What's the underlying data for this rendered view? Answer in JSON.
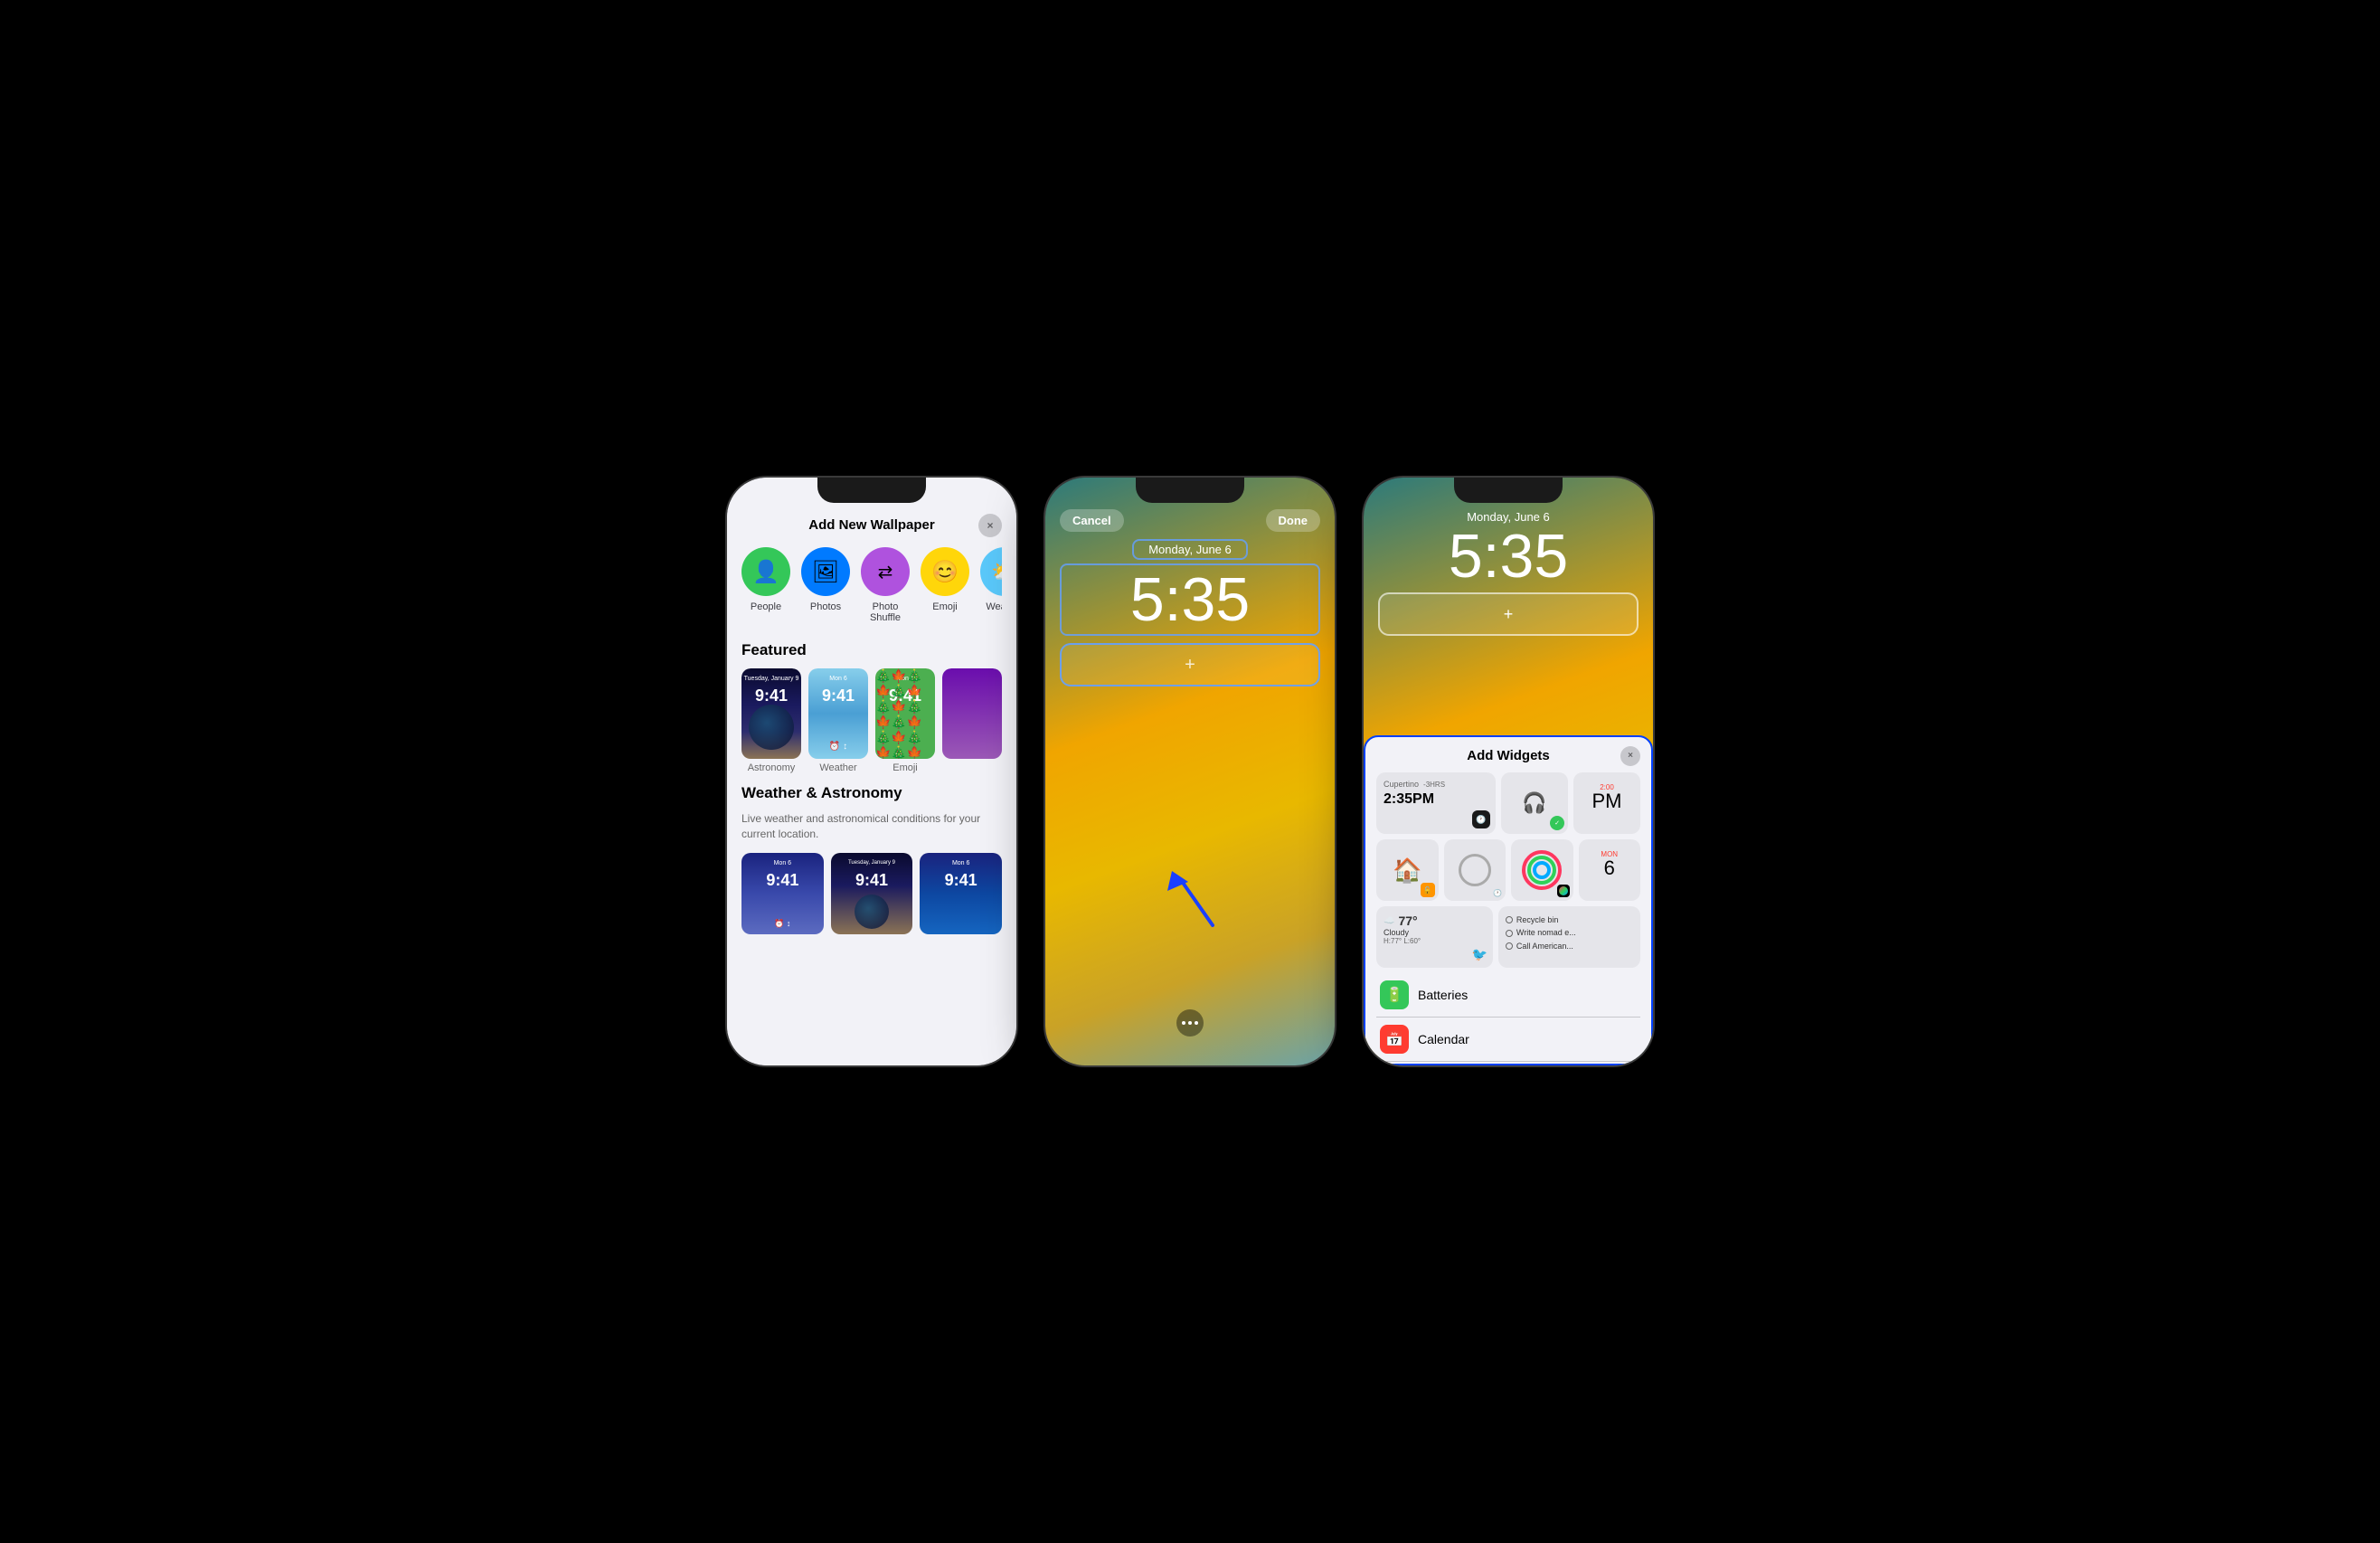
{
  "scene": {
    "bg_color": "#000000"
  },
  "phone1": {
    "sheet_title": "Add New Wallpaper",
    "close_label": "×",
    "options": [
      {
        "label": "People",
        "icon": "👤",
        "color": "green"
      },
      {
        "label": "Photos",
        "icon": "🖼",
        "color": "blue"
      },
      {
        "label": "Photo Shuffle",
        "icon": "⇄",
        "color": "purple"
      },
      {
        "label": "Emoji",
        "icon": "😊",
        "color": "yellow"
      },
      {
        "label": "Weather",
        "icon": "⛅",
        "color": "teal"
      }
    ],
    "featured_label": "Featured",
    "featured_items": [
      {
        "label": "Astronomy",
        "type": "astronomy",
        "time": "9:41",
        "date": "Tuesday, January 9"
      },
      {
        "label": "Weather",
        "type": "weather",
        "time": "9:41",
        "date": "Mon 6"
      },
      {
        "label": "Emoji",
        "type": "emoji",
        "time": "9:41",
        "date": "Mon 6"
      }
    ],
    "weather_section_title": "Weather & Astronomy",
    "weather_section_desc": "Live weather and astronomical conditions for your current location.",
    "weather_thumbs": [
      {
        "time": "9:41",
        "date": "Mon 6"
      },
      {
        "time": "9:41",
        "date": "Tuesday, January 9"
      },
      {
        "time": "9:41",
        "date": "Mon 6"
      }
    ]
  },
  "phone2": {
    "cancel_label": "Cancel",
    "done_label": "Done",
    "date": "Monday, June 6",
    "time": "5:35",
    "plus_icon": "+",
    "dots": "..."
  },
  "phone3": {
    "date": "Monday, June 6",
    "time": "5:35",
    "plus_icon": "+",
    "add_widgets_title": "Add Widgets",
    "close_label": "×",
    "widgets": {
      "row1": [
        {
          "type": "weather",
          "city": "Cupertino",
          "offset": "-3HRS",
          "time": "2:35PM"
        },
        {
          "type": "airpods"
        },
        {
          "type": "calendar",
          "month": "2:00",
          "day": "PM"
        }
      ],
      "row2": [
        {
          "type": "lock"
        },
        {
          "type": "circle"
        },
        {
          "type": "fitness"
        },
        {
          "type": "calendar2",
          "month": "MON",
          "day": "6"
        }
      ],
      "row3": [
        {
          "type": "weather2",
          "temp": "77°",
          "condition": "Cloudy",
          "hi": "H:77° L:60°"
        },
        {
          "type": "todo",
          "items": [
            "Recycle bin",
            "Write nomad e...",
            "Call American..."
          ]
        }
      ]
    },
    "apps": [
      {
        "name": "Batteries",
        "icon": "🔋",
        "color": "green"
      },
      {
        "name": "Calendar",
        "icon": "📅",
        "color": "red"
      }
    ]
  }
}
